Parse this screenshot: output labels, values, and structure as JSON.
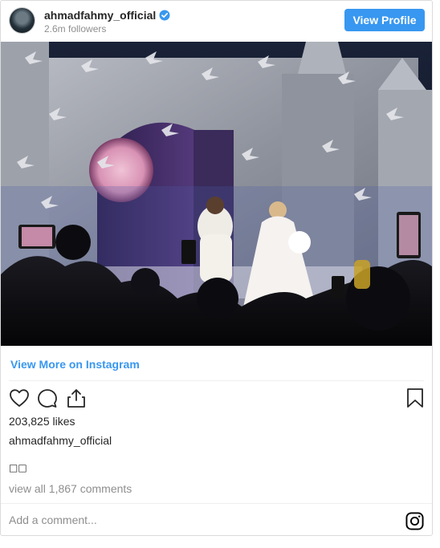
{
  "header": {
    "username": "ahmadfahmy_official",
    "followers": "2.6m followers",
    "view_profile_label": "View Profile"
  },
  "post": {
    "image_alt": "Wedding stage with bride and groom, doves and glittering castle backdrop",
    "view_more_label": "View More on Instagram",
    "likes": "203,825 likes",
    "caption_username": "ahmadfahmy_official",
    "caption_text": "□□",
    "comments_link": "view all 1,867 comments",
    "comment_placeholder": "Add a comment..."
  },
  "icons": {
    "like": "heart-icon",
    "comment": "comment-icon",
    "share": "share-icon",
    "save": "bookmark-icon",
    "brand": "instagram-icon",
    "verified": "verified-badge-icon"
  },
  "colors": {
    "accent": "#3897f0",
    "text": "#262626",
    "muted": "#8e8e8e"
  }
}
